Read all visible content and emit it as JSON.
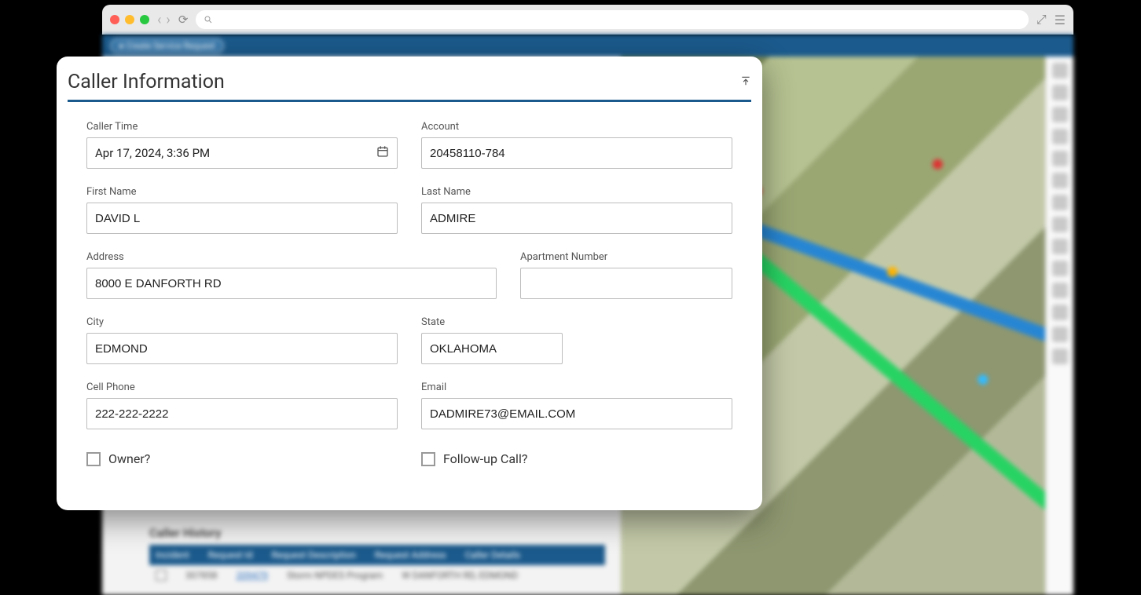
{
  "browser": {
    "search_icon": "search"
  },
  "topbar": {
    "create_label": "● Create Service Request"
  },
  "modal": {
    "title": "Caller Information",
    "labels": {
      "caller_time": "Caller Time",
      "account": "Account",
      "first_name": "First Name",
      "last_name": "Last Name",
      "address": "Address",
      "apt": "Apartment Number",
      "city": "City",
      "state": "State",
      "cell": "Cell Phone",
      "email": "Email",
      "owner": "Owner?",
      "followup": "Follow-up Call?"
    },
    "values": {
      "caller_time": "Apr 17, 2024, 3:36 PM",
      "account": "20458110-784",
      "first_name": "DAVID L",
      "last_name": "ADMIRE",
      "address": "8000 E DANFORTH RD",
      "apt": "",
      "city": "EDMOND",
      "state": "OKLAHOMA",
      "cell": "222-222-2222",
      "email": "DADMIRE73@EMAIL.COM"
    }
  },
  "history": {
    "title": "Caller History",
    "headers": [
      "Incident",
      "Request Id",
      "Request Description",
      "Request Address",
      "Caller Details"
    ],
    "row": {
      "incident": "307858",
      "request_id": "209479",
      "desc": "Storm NPDES Program",
      "addr": "W DANFORTH RD, EDMOND",
      "details": ""
    }
  }
}
